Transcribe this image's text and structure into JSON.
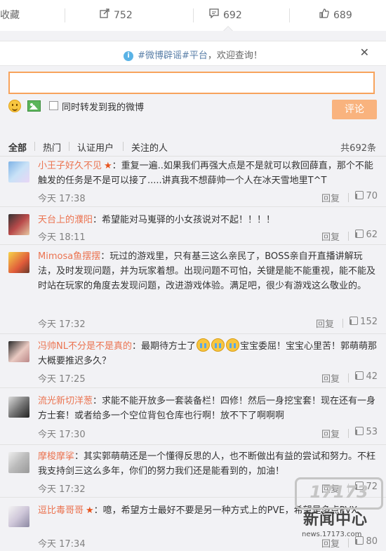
{
  "topbar": {
    "collect_label": "收藏",
    "forward_count": "752",
    "comment_count": "692",
    "like_count": "689"
  },
  "notice": {
    "tag": "#微博辟谣#平台",
    "text": "，欢迎查询！"
  },
  "composer": {
    "input_value": "",
    "share_label": "同时转发到我的微博",
    "post_label": "评论"
  },
  "tabs": {
    "items": [
      "全部",
      "热门",
      "认证用户",
      "关注的人"
    ],
    "total": "共692条"
  },
  "comments": [
    {
      "name": "小王子好久不见",
      "text": "：重复一遍..如果我们再强大点是不是就可以救回薛直，那个不能触发的任务是不是可以接了.....讲真我不想薛帅一个人在冰天雪地里T^T",
      "time": "今天 17:38",
      "reply": "回复",
      "likes": "70"
    },
    {
      "name": "天台上的濮阳",
      "text": "：希望能对马嵬驿的小女孩说对不起！！！！",
      "time": "今天 18:11",
      "reply": "回复",
      "likes": "62"
    },
    {
      "name": "Mimosa鱼摆摆",
      "text": "：玩过的游戏里，只有基三这么亲民了，BOSS亲自开直播讲解玩法，及时发现问题，并为玩家着想。出现问题不可怕，关键是能不能重视，能不能及时站在玩家的角度去发现问题，改进游戏体验。满足吧，很少有游戏这么敬业的。",
      "time": "今天 17:32",
      "reply": "回复",
      "likes": "152"
    },
    {
      "name": "冯帅NL不分是不是真的",
      "text_before": "：最期待方士了",
      "text_after": "宝宝委屈！宝宝心里苦！郭萌萌那大概要推迟多久？",
      "time": "今天 17:25",
      "reply": "回复",
      "likes": "42"
    },
    {
      "name": "流光新切洋葱",
      "text": "：求能不能开放多一套装备栏！四修！然后一身挖宝套！现在还有一身方士套！或者给多一个空位背包仓库也行啊！放不下了啊啊啊",
      "time": "今天 17:30",
      "reply": "回复",
      "likes": "53"
    },
    {
      "name": "摩梭摩挲",
      "text": "：其实郭萌萌还是一个懂得反思的人，也不断做出有益的尝试和努力。不枉我支持剑三这么多年，你们的努力我们还是能看到的，加油！",
      "time": "今天 17:32",
      "reply": "回复",
      "likes": "72"
    },
    {
      "name": "逗比毒哥哥",
      "text": "：噫，希望方士最好不要是另一种方式上的PVE，希望是多点PVX",
      "time": "今天 17:34",
      "reply": "回复",
      "likes": "80"
    }
  ],
  "watermark": {
    "logo": "17173",
    "title": "新闻中心",
    "url": "news.17173.com"
  }
}
